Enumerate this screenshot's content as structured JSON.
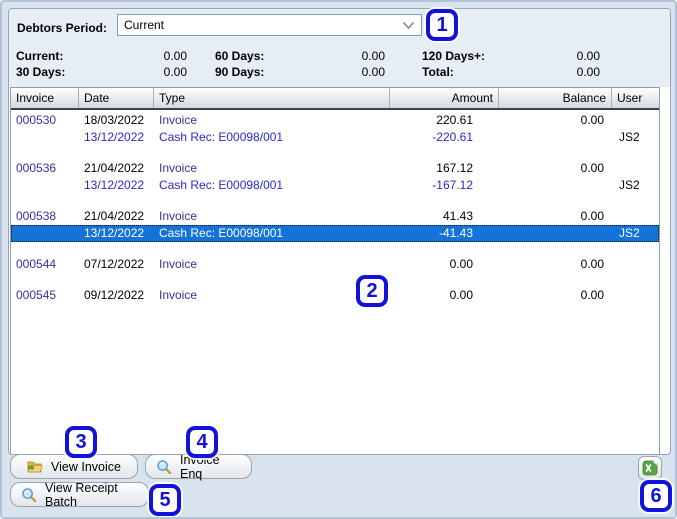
{
  "period": {
    "label": "Debtors Period:",
    "value": "Current"
  },
  "summary": {
    "items": [
      {
        "label": "Current:",
        "value": "0.00"
      },
      {
        "label": "60 Days:",
        "value": "0.00"
      },
      {
        "label": "120 Days+:",
        "value": "0.00"
      },
      {
        "label": "30 Days:",
        "value": "0.00"
      },
      {
        "label": "90 Days:",
        "value": "0.00"
      },
      {
        "label": "Total:",
        "value": "0.00"
      }
    ]
  },
  "grid": {
    "columns": [
      {
        "label": "Invoice"
      },
      {
        "label": "Date"
      },
      {
        "label": "Type"
      },
      {
        "label": "Amount"
      },
      {
        "label": "Balance"
      },
      {
        "label": "User"
      }
    ],
    "groups": [
      {
        "rows": [
          {
            "kind": "invoice",
            "selected": false,
            "invoice": "000530",
            "date": "18/03/2022",
            "type": "Invoice",
            "amount": "220.61",
            "balance": "0.00",
            "user": ""
          },
          {
            "kind": "receipt",
            "selected": false,
            "invoice": "",
            "date": "13/12/2022",
            "type": "Cash Rec: E00098/001",
            "amount": "-220.61",
            "balance": "",
            "user": "JS2"
          }
        ]
      },
      {
        "rows": [
          {
            "kind": "invoice",
            "selected": false,
            "invoice": "000536",
            "date": "21/04/2022",
            "type": "Invoice",
            "amount": "167.12",
            "balance": "0.00",
            "user": ""
          },
          {
            "kind": "receipt",
            "selected": false,
            "invoice": "",
            "date": "13/12/2022",
            "type": "Cash Rec: E00098/001",
            "amount": "-167.12",
            "balance": "",
            "user": "JS2"
          }
        ]
      },
      {
        "rows": [
          {
            "kind": "invoice",
            "selected": false,
            "invoice": "000538",
            "date": "21/04/2022",
            "type": "Invoice",
            "amount": "41.43",
            "balance": "0.00",
            "user": ""
          },
          {
            "kind": "receipt",
            "selected": true,
            "invoice": "",
            "date": "13/12/2022",
            "type": "Cash Rec: E00098/001",
            "amount": "-41.43",
            "balance": "",
            "user": "JS2"
          }
        ]
      },
      {
        "rows": [
          {
            "kind": "invoice",
            "selected": false,
            "invoice": "000544",
            "date": "07/12/2022",
            "type": "Invoice",
            "amount": "0.00",
            "balance": "0.00",
            "user": ""
          }
        ]
      },
      {
        "rows": [
          {
            "kind": "invoice",
            "selected": false,
            "invoice": "000545",
            "date": "09/12/2022",
            "type": "Invoice",
            "amount": "0.00",
            "balance": "0.00",
            "user": ""
          }
        ]
      }
    ]
  },
  "buttons": {
    "view_invoice": "View Invoice",
    "invoice_enq": "Invoice Enq",
    "view_receipt_batch": "View Receipt Batch"
  },
  "icons": {
    "excel": "excel-export-icon",
    "folder": "open-folder-icon",
    "magnifier": "magnifier-icon",
    "chevron": "chevron-down-icon"
  },
  "annotations": [
    {
      "label": "1"
    },
    {
      "label": "2"
    },
    {
      "label": "3"
    },
    {
      "label": "4"
    },
    {
      "label": "5"
    },
    {
      "label": "6"
    }
  ],
  "colors": {
    "selection_bg": "#1373d8",
    "invoice_link": "#333399",
    "receipt_text": "#2a2acc",
    "annotation_blue": "#1212d8",
    "window_bg": "#d9e3ee",
    "band_bg": "#e7edf5"
  }
}
